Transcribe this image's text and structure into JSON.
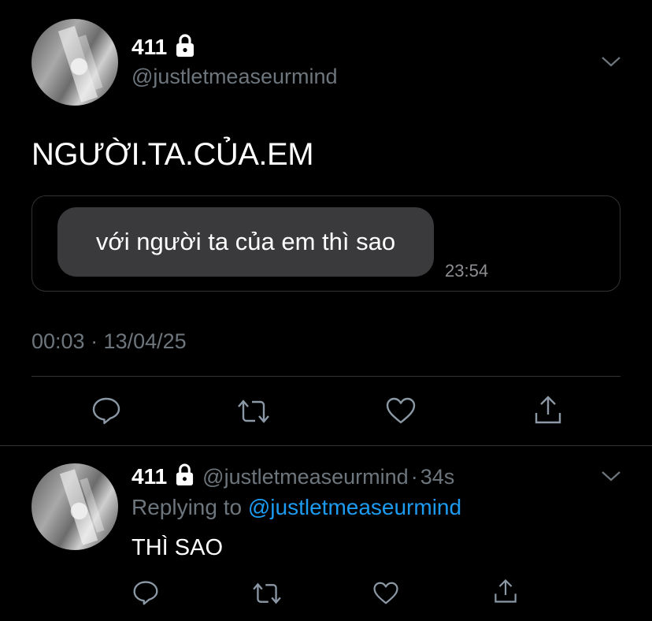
{
  "main_tweet": {
    "display_name": "411",
    "handle": "@justletmeaseurmind",
    "text": "NGƯỜI.TA.CỦA.EM",
    "embedded_message": {
      "text": "với người ta của em thì sao",
      "time": "23:54"
    },
    "timestamp": "00:03 · 13/04/25"
  },
  "reply_tweet": {
    "display_name": "411",
    "handle": "@justletmeaseurmind",
    "separator": "·",
    "age": "34s",
    "replying_label": "Replying to",
    "replying_handle": "@justletmeaseurmind",
    "text": "THÌ SAO"
  },
  "icons": {
    "lock": "lock-icon",
    "chevron": "chevron-down-icon",
    "reply": "reply-icon",
    "retweet": "retweet-icon",
    "like": "like-icon",
    "share": "share-icon"
  },
  "colors": {
    "background": "#000000",
    "muted_text": "#6e767d",
    "link": "#1d9bf0",
    "bubble": "#3a3a3c",
    "border": "#2f3336"
  }
}
